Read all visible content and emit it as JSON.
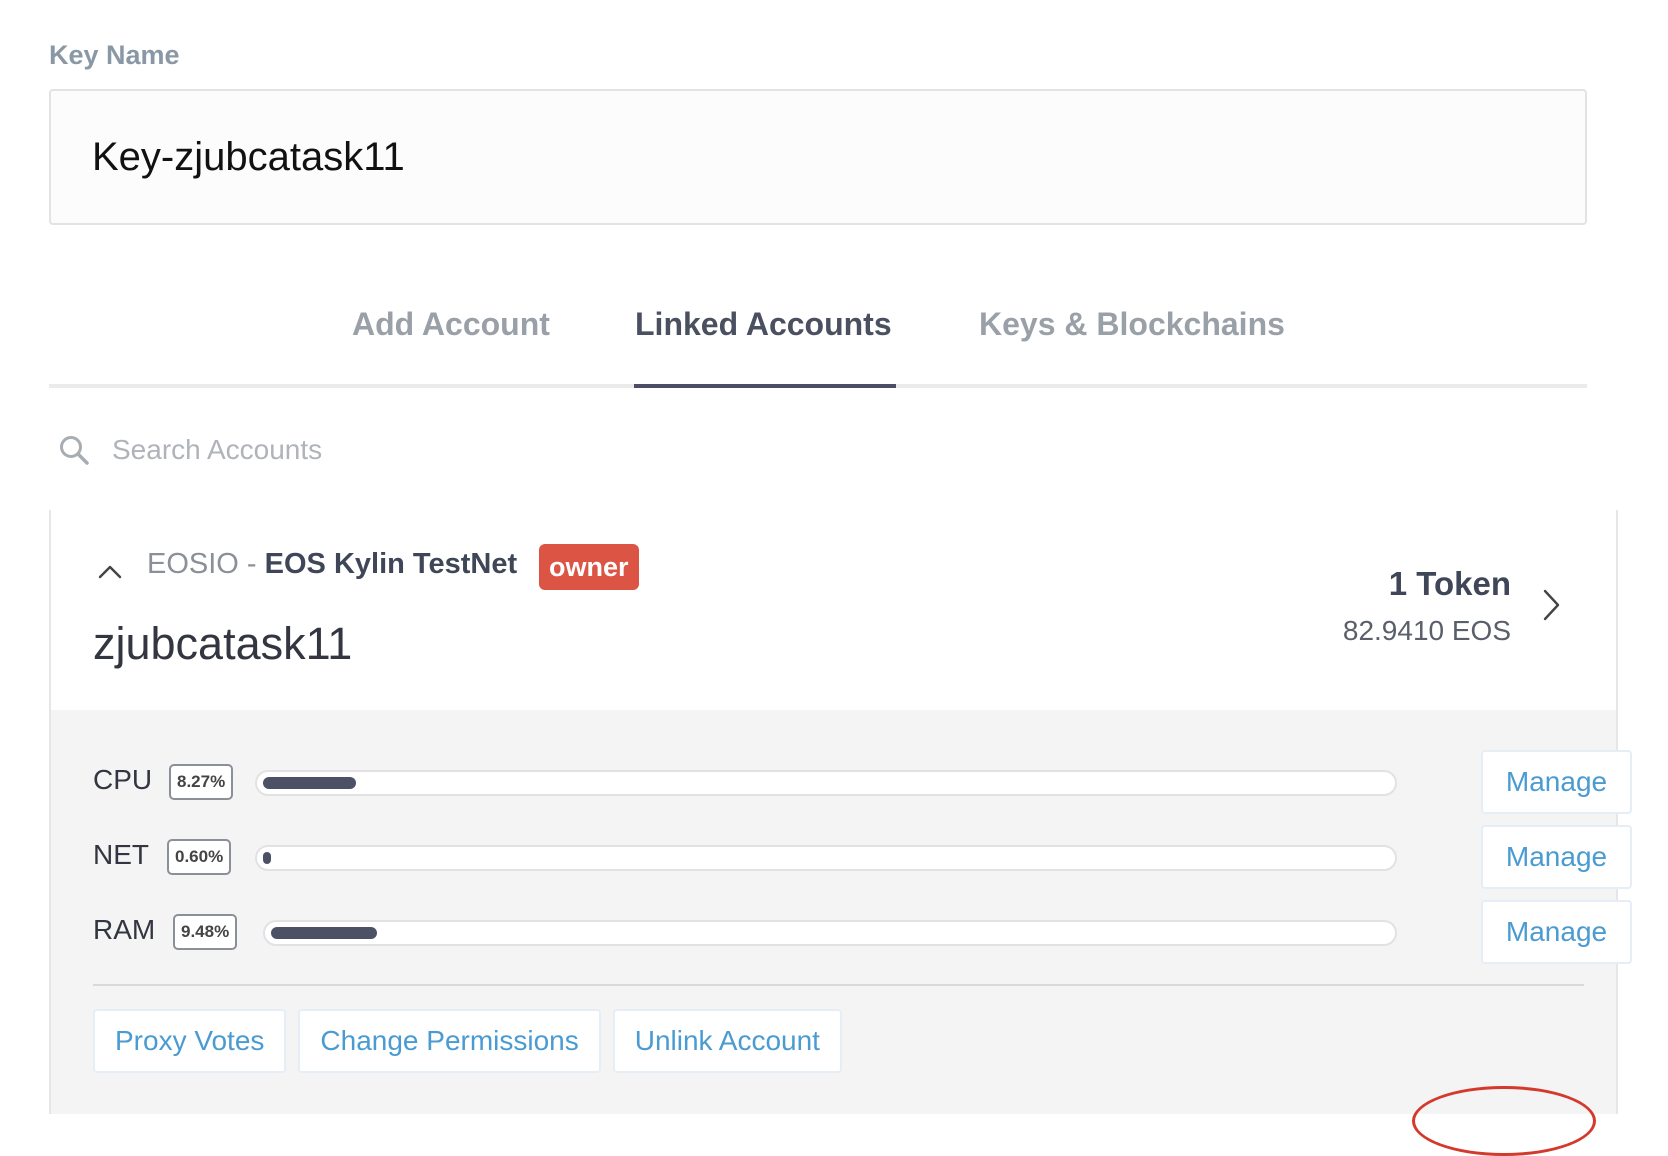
{
  "key": {
    "label": "Key Name",
    "value": "Key-zjubcatask11"
  },
  "tabs": [
    {
      "label": "Add Account",
      "active": false
    },
    {
      "label": "Linked Accounts",
      "active": true
    },
    {
      "label": "Keys & Blockchains",
      "active": false
    }
  ],
  "search": {
    "placeholder": "Search Accounts",
    "value": "",
    "icon": "search-icon"
  },
  "account": {
    "network_prefix": "EOSIO - ",
    "network_name": "EOS Kylin TestNet",
    "badge": "owner",
    "name": "zjubcatask11",
    "token_count": "1 Token",
    "balance": "82.9410 EOS",
    "collapse_icon": "chevron-up-icon",
    "open_icon": "chevron-right-icon"
  },
  "resources": [
    {
      "label": "CPU",
      "percent": "8.27%",
      "fill": 0.0827,
      "manage_label": "Manage"
    },
    {
      "label": "NET",
      "percent": "0.60%",
      "fill": 0.006,
      "manage_label": "Manage"
    },
    {
      "label": "RAM",
      "percent": "9.48%",
      "fill": 0.0948,
      "manage_label": "Manage"
    }
  ],
  "actions": {
    "proxy_votes": "Proxy Votes",
    "change_permissions": "Change Permissions",
    "unlink_account": "Unlink Account"
  },
  "colors": {
    "accent": "#4a9bd1",
    "owner_badge": "#dc5544",
    "bar_fill": "#4d5166",
    "highlight": "#d43a2c"
  }
}
